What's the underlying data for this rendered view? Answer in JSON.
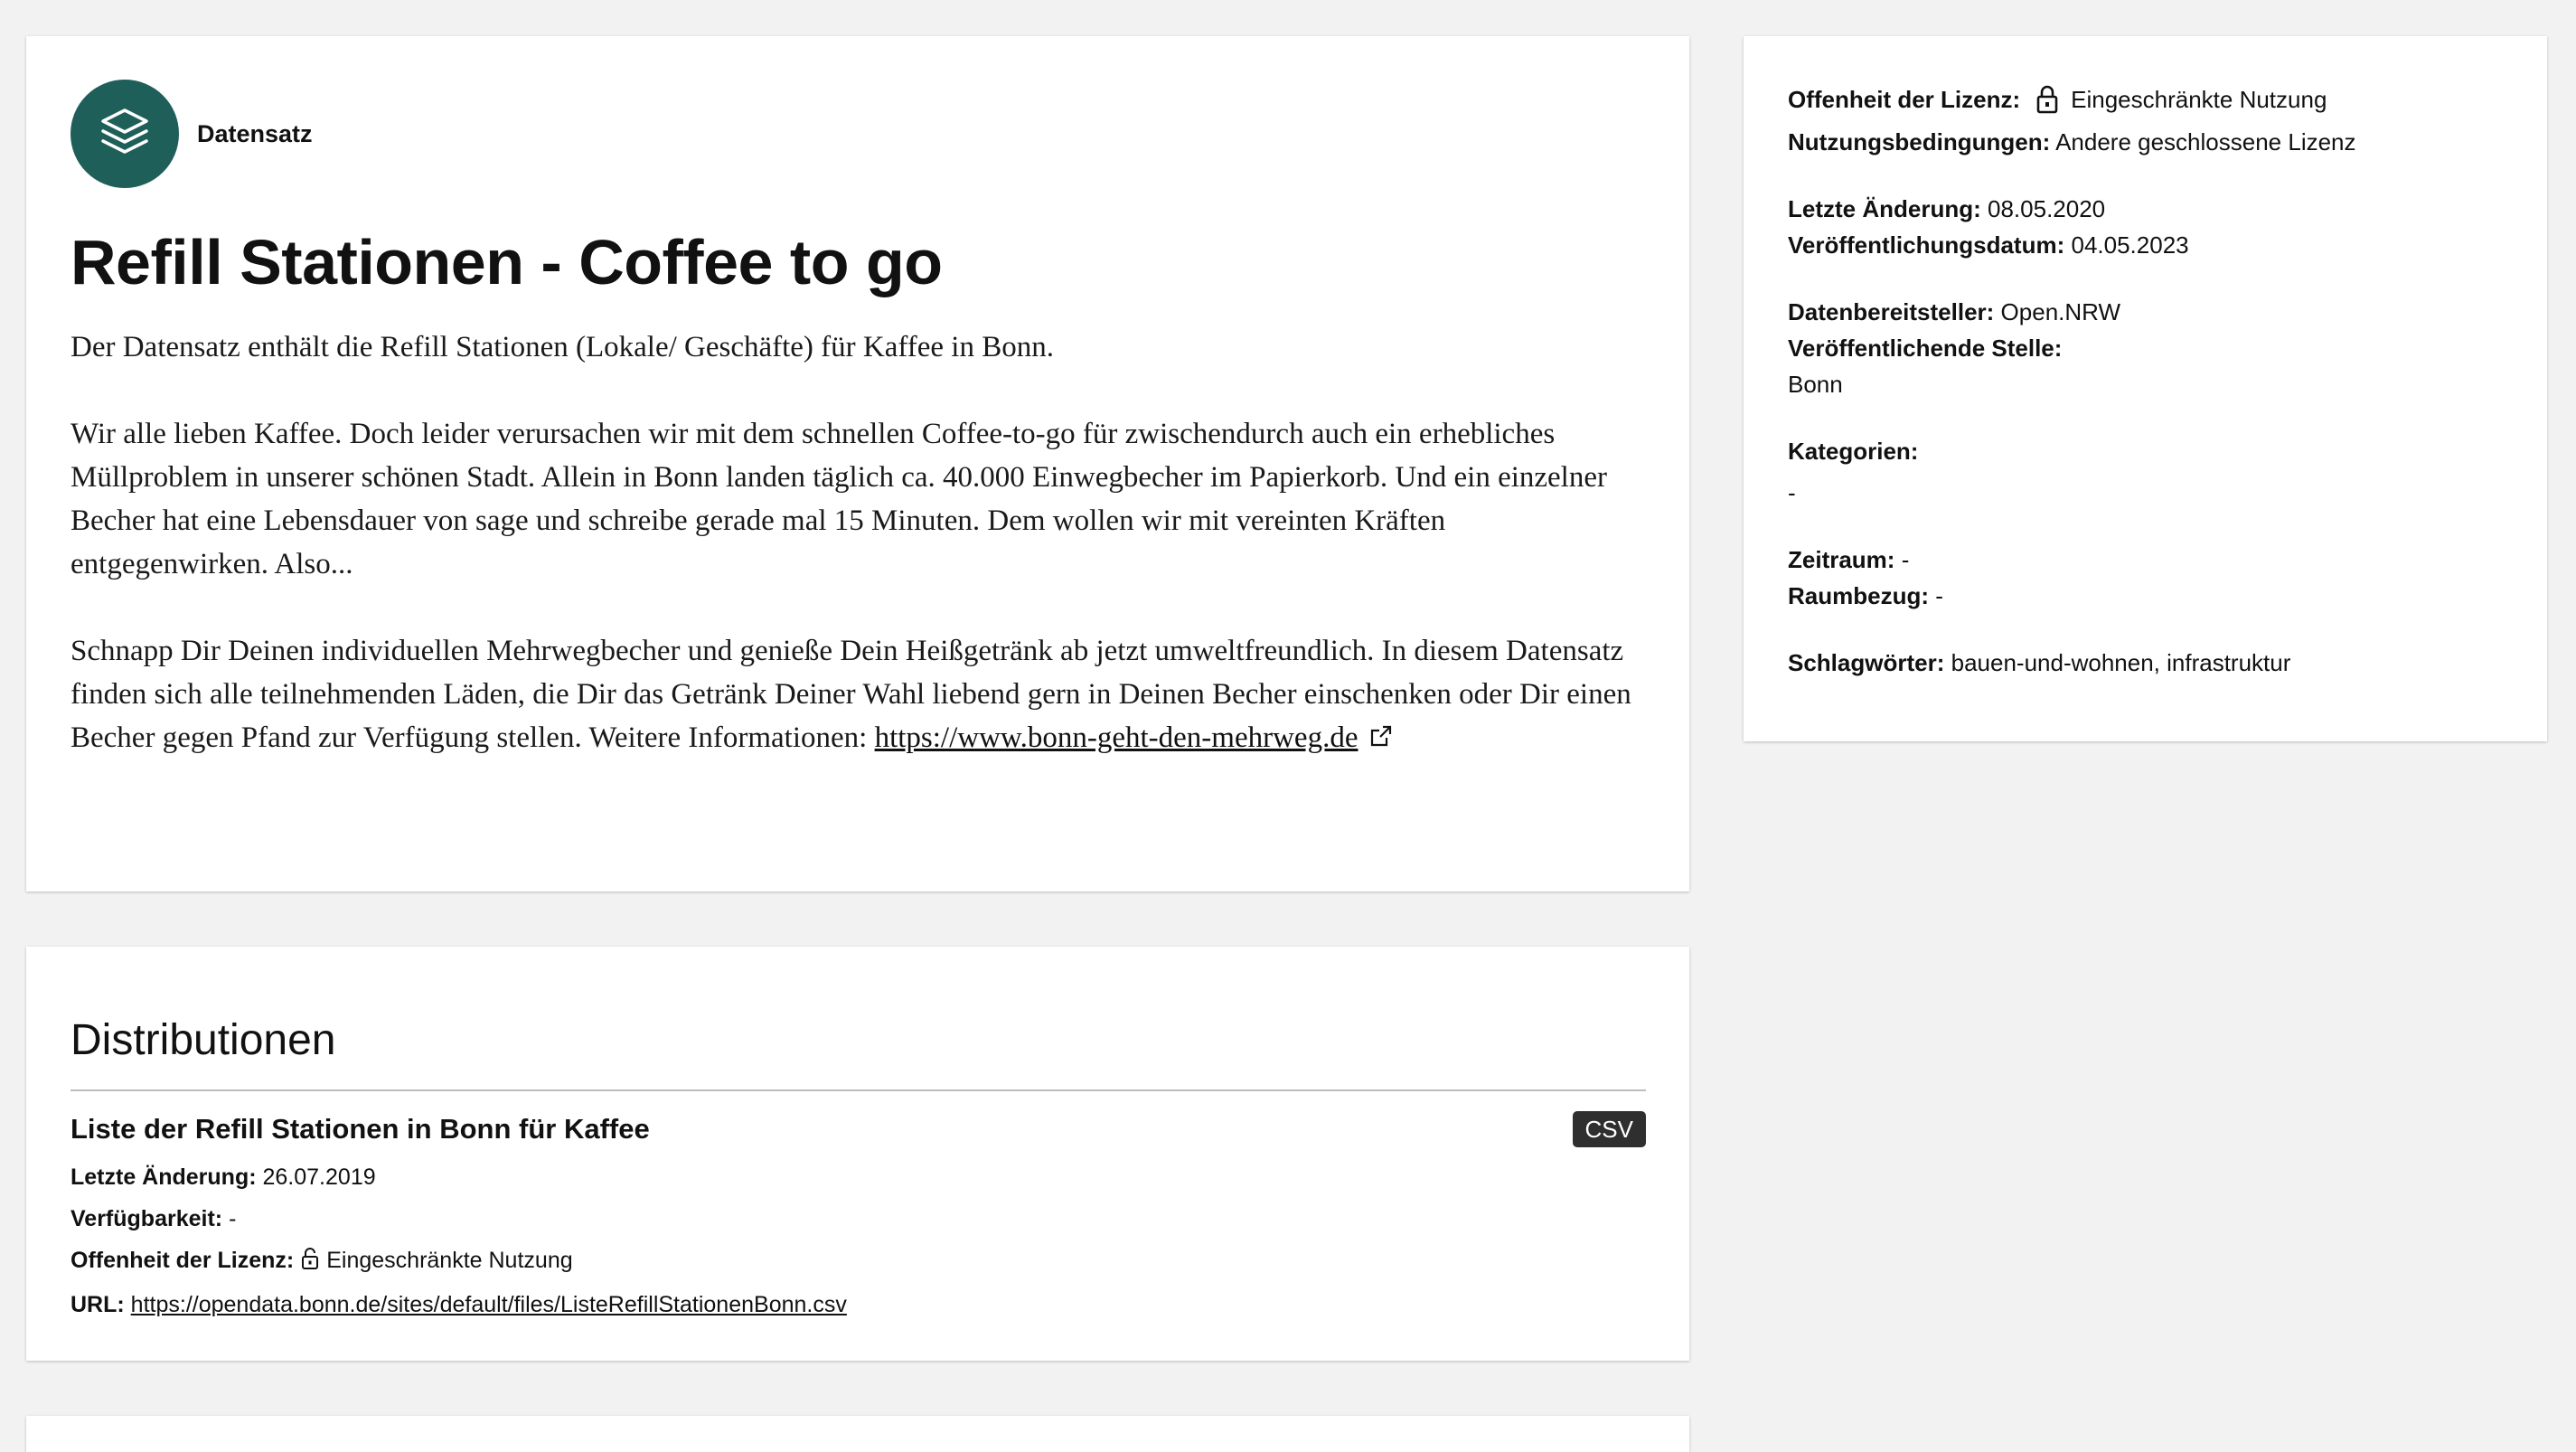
{
  "dataset": {
    "badge_label": "Datensatz",
    "badge_icon": "layers-icon",
    "badge_color": "#1f5f5a",
    "title": "Refill Stationen - Coffee to go",
    "description": {
      "p1": "Der Datensatz enthält die Refill Stationen (Lokale/ Geschäfte) für Kaffee in Bonn.",
      "p2": "Wir alle lieben Kaffee. Doch leider verursachen wir mit dem schnellen Coffee-to-go für zwischendurch auch ein erhebliches Müllproblem in unserer schönen Stadt. Allein in Bonn landen täglich ca. 40.000 Einwegbecher im Papierkorb. Und ein einzelner Becher hat eine Lebensdauer von sage und schreibe gerade mal 15 Minuten. Dem wollen wir mit vereinten Kräften entgegenwirken. Also...",
      "p3": "Schnapp Dir Deinen individuellen Mehrwegbecher und genieße Dein Heißgetränk ab jetzt umweltfreundlich. In diesem Datensatz finden sich alle teilnehmenden Läden, die Dir das Getränk Deiner Wahl liebend gern in Deinen Becher einschenken oder Dir einen Becher gegen Pfand zur Verfügung stellen. Weitere Informationen:",
      "link_text": "https://www.bonn-geht-den-mehrweg.de",
      "link_icon": "external-link-icon"
    }
  },
  "sidebar": {
    "license_openness_label": "Offenheit der Lizenz:",
    "license_openness_value": "Eingeschränkte Nutzung",
    "license_icon": "lock-icon",
    "terms_label": "Nutzungsbedingungen:",
    "terms_value": "Andere geschlossene Lizenz",
    "last_modified_label": "Letzte Änderung:",
    "last_modified_value": "08.05.2020",
    "published_label": "Veröffentlichungsdatum:",
    "published_value": "04.05.2023",
    "provider_label": "Datenbereitsteller:",
    "provider_value": "Open.NRW",
    "publisher_label": "Veröffentlichende Stelle:",
    "publisher_value": "Bonn",
    "categories_label": "Kategorien:",
    "categories_value": "-",
    "timespan_label": "Zeitraum:",
    "timespan_value": "-",
    "spatial_label": "Raumbezug:",
    "spatial_value": "-",
    "keywords_label": "Schlagwörter:",
    "keywords_value": "bauen-und-wohnen, infrastruktur"
  },
  "distributions": {
    "heading": "Distributionen",
    "items": [
      {
        "name": "Liste der Refill Stationen in Bonn für Kaffee",
        "format": "CSV",
        "last_modified_label": "Letzte Änderung:",
        "last_modified_value": "26.07.2019",
        "availability_label": "Verfügbarkeit:",
        "availability_value": "-",
        "license_label": "Offenheit der Lizenz:",
        "license_value": "Eingeschränkte Nutzung",
        "license_icon": "lock-icon",
        "url_label": "URL:",
        "url_value": "https://opendata.bonn.de/sites/default/files/ListeRefillStationenBonn.csv"
      }
    ]
  }
}
